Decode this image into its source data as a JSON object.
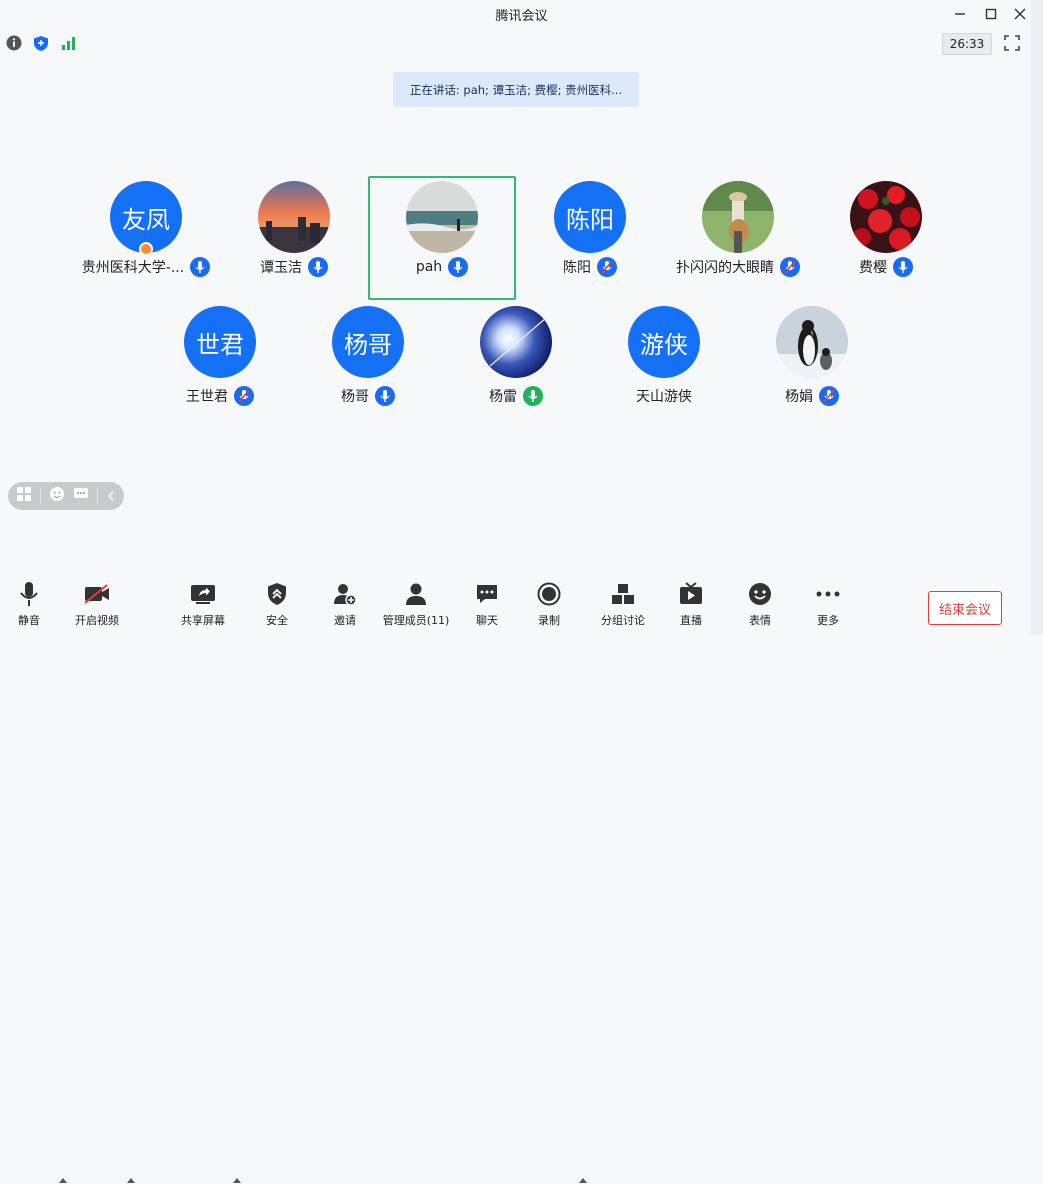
{
  "window": {
    "title": "腾讯会议"
  },
  "infobar": {
    "timer": "26:33"
  },
  "speaking": {
    "text": "正在讲话: pah; 谭玉洁; 费樱; 贵州医科..."
  },
  "participants": [
    {
      "name": "贵州医科大学-...",
      "avatar_text": "友凤",
      "avatar_type": "text",
      "mic": "on",
      "host": true
    },
    {
      "name": "谭玉洁",
      "avatar_type": "photo-sunset",
      "mic": "on"
    },
    {
      "name": "pah",
      "avatar_type": "photo-beach",
      "mic": "on",
      "active": true
    },
    {
      "name": "陈阳",
      "avatar_text": "陈阳",
      "avatar_type": "text",
      "mic": "muted"
    },
    {
      "name": "扑闪闪的大眼睛",
      "avatar_type": "photo-guitar",
      "mic": "muted"
    },
    {
      "name": "费樱",
      "avatar_type": "photo-flowers",
      "mic": "on"
    },
    {
      "name": "王世君",
      "avatar_text": "世君",
      "avatar_type": "text",
      "mic": "muted"
    },
    {
      "name": "杨哥",
      "avatar_text": "杨哥",
      "avatar_type": "text",
      "mic": "on"
    },
    {
      "name": "杨雷",
      "avatar_type": "photo-sun",
      "mic": "speaking"
    },
    {
      "name": "天山游侠",
      "avatar_text": "游侠",
      "avatar_type": "text",
      "mic": "none"
    },
    {
      "name": "杨娟",
      "avatar_type": "photo-penguin",
      "mic": "muted"
    }
  ],
  "toolbar": {
    "mute": "静音",
    "video": "开启视频",
    "share": "共享屏幕",
    "security": "安全",
    "invite": "邀请",
    "members": "管理成员(11)",
    "chat": "聊天",
    "record": "录制",
    "breakout": "分组讨论",
    "live": "直播",
    "reactions": "表情",
    "more": "更多",
    "end": "结束会议"
  },
  "colors": {
    "accent": "#1471f5",
    "active_border": "#2dbd6e",
    "end": "#e23c3c"
  }
}
